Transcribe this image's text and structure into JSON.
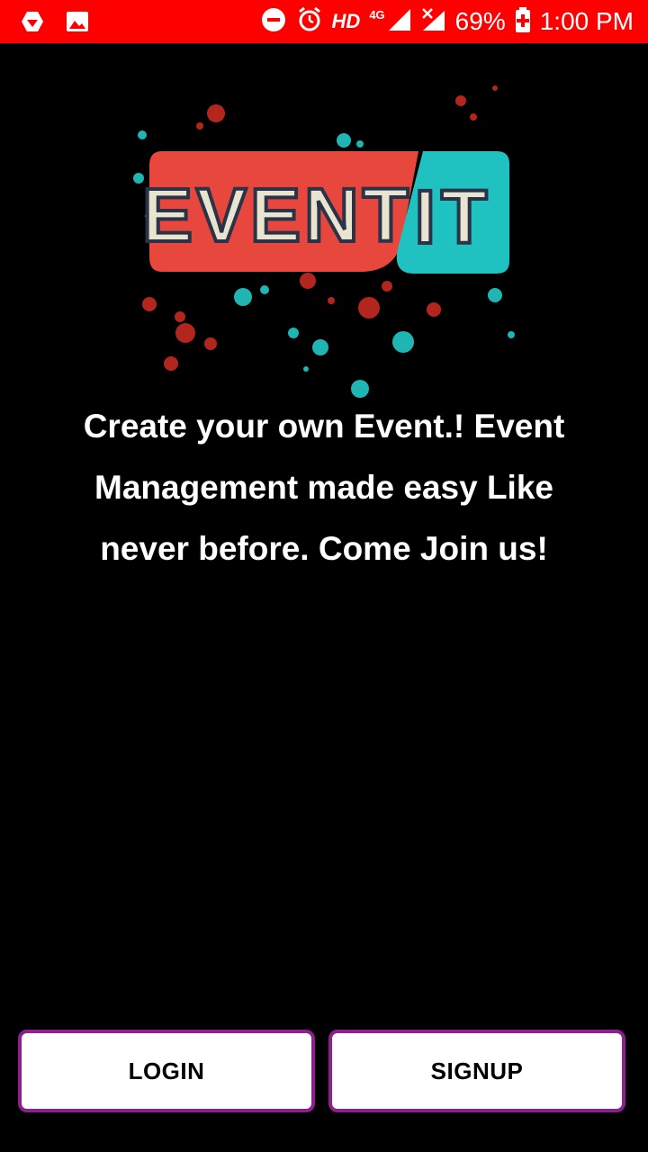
{
  "status_bar": {
    "hd_label": "HD",
    "network_label": "4G",
    "battery_percent": "69%",
    "time": "1:00 PM",
    "icons": [
      "app-notification-icon",
      "gallery-icon",
      "do-not-disturb-icon",
      "alarm-icon",
      "signal-icon",
      "no-signal-icon",
      "battery-charging-icon"
    ],
    "background_color": "#ff0000"
  },
  "logo": {
    "text_left": "EVENT",
    "text_right": "IT",
    "colors": {
      "red": "#e8473d",
      "teal": "#1fc2c0"
    }
  },
  "tagline": "Create your own Event.! Event Management made easy Like never before. Come Join us!",
  "buttons": {
    "login_label": "LOGIN",
    "signup_label": "SIGNUP",
    "border_color": "#8e1f8e"
  }
}
